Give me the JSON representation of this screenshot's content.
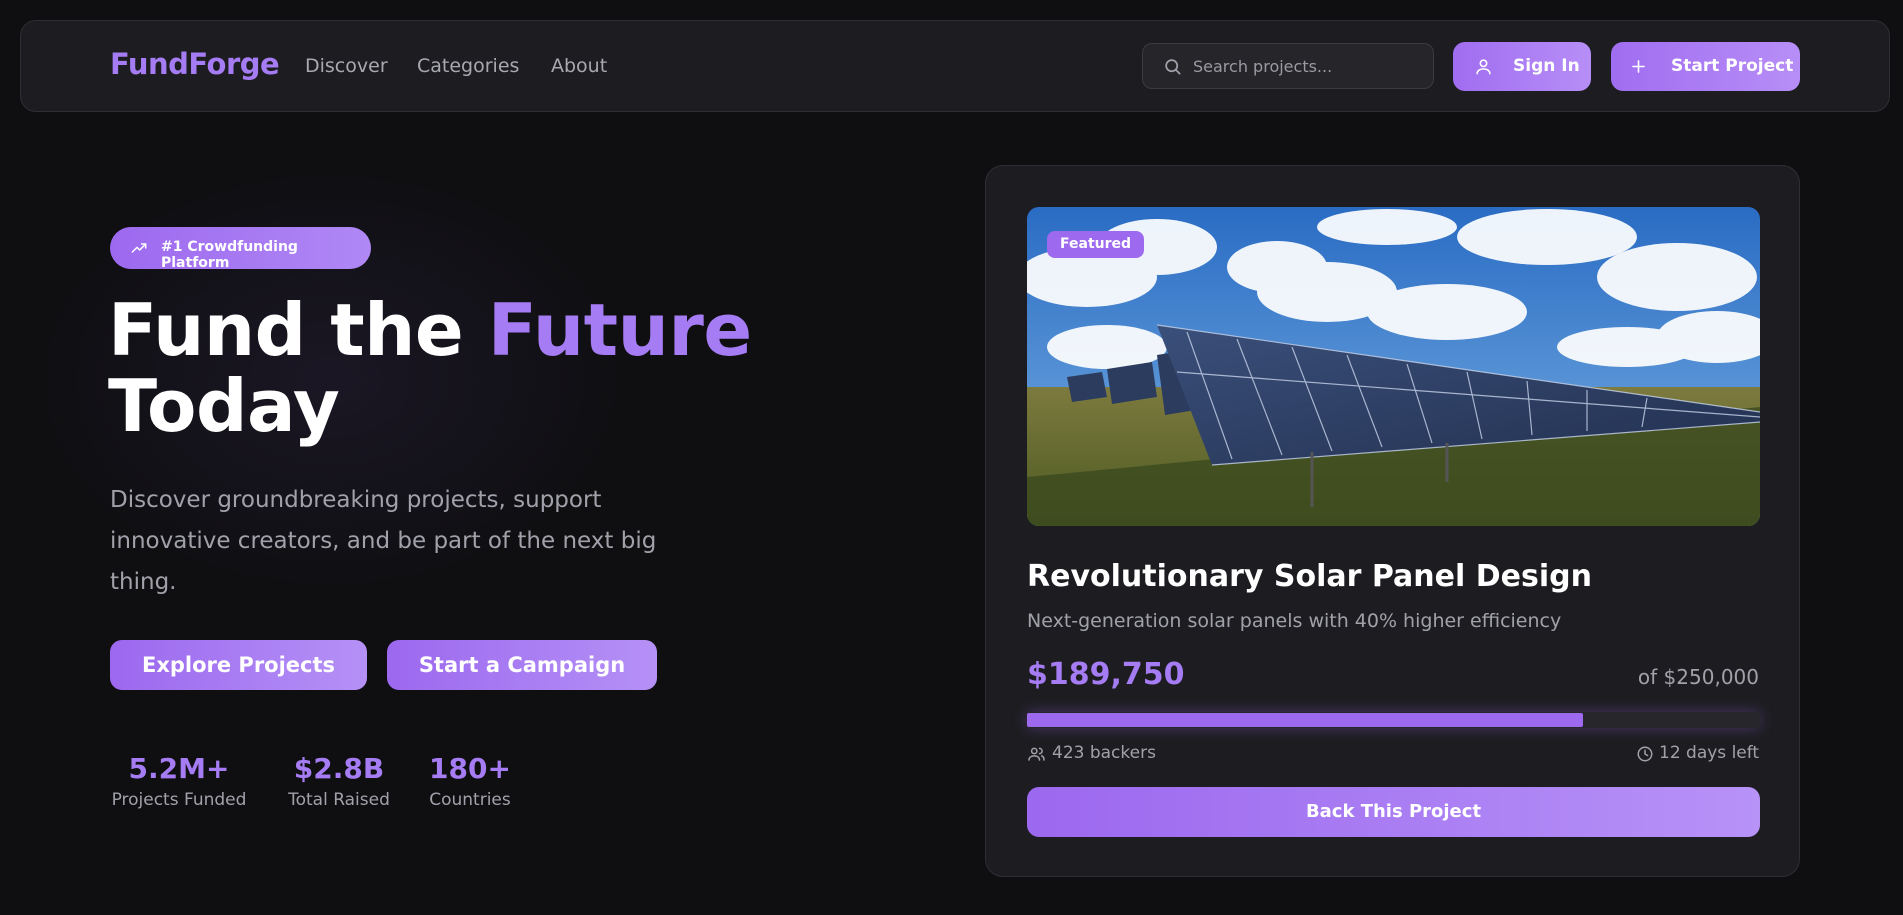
{
  "brand": {
    "name": "FundForge",
    "accent": "#a57cf3"
  },
  "nav": {
    "links": [
      "Discover",
      "Categories",
      "About"
    ],
    "search_placeholder": "Search projects...",
    "sign_in": "Sign In",
    "start_project": "Start Project",
    "icons": {
      "search": "search-icon",
      "user": "user-icon",
      "plus": "plus-icon"
    }
  },
  "hero": {
    "badge": "#1 Crowdfunding Platform",
    "badge_icon": "trending-up-icon",
    "title_part1": "Fund the ",
    "title_accent": "Future",
    "title_part2": "Today",
    "subtitle": "Discover groundbreaking projects, support innovative creators, and be part of the next big thing.",
    "primary_cta": "Explore Projects",
    "secondary_cta": "Start a Campaign",
    "stats": [
      {
        "value": "5.2M+",
        "label": "Projects Funded"
      },
      {
        "value": "$2.8B",
        "label": "Total Raised"
      },
      {
        "value": "180+",
        "label": "Countries"
      }
    ]
  },
  "featured_project": {
    "tag": "Featured",
    "title": "Revolutionary Solar Panel Design",
    "description": "Next-generation solar panels with 40% higher efficiency",
    "raised": "$189,750",
    "goal": "of $250,000",
    "progress_fraction": 0.759,
    "backers": "423 backers",
    "days_left": "12 days left",
    "cta": "Back This Project",
    "icons": {
      "backers": "users-icon",
      "time": "clock-icon"
    }
  }
}
